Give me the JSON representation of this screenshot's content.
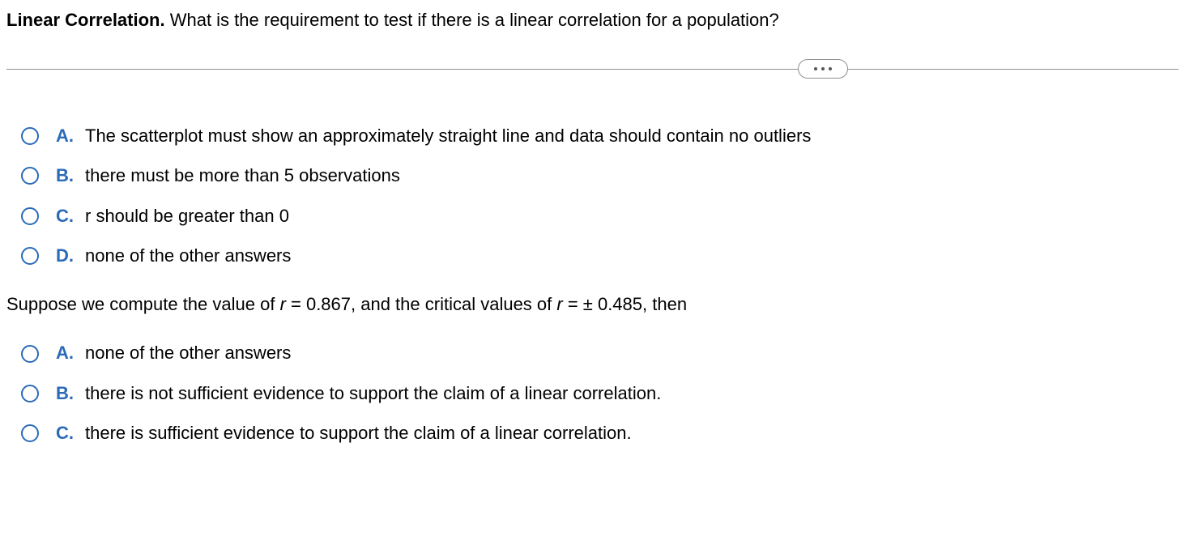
{
  "header": {
    "title_bold": "Linear Correlation.",
    "title_rest": " What is the requirement to test if there is a linear correlation for a population?"
  },
  "question1": {
    "options": [
      {
        "letter": "A.",
        "text": "The scatterplot must show an approximately straight line and data should contain no outliers"
      },
      {
        "letter": "B.",
        "text": "there must be more than 5 observations"
      },
      {
        "letter": "C.",
        "text": "r should be greater than 0"
      },
      {
        "letter": "D.",
        "text": "none of the other answers"
      }
    ]
  },
  "subquestion": {
    "prefix": "Suppose we compute the value of ",
    "r": "r",
    "eq1": " = 0.867, and the critical values of ",
    "r2": "r",
    "eq2": " =  ± 0.485, then"
  },
  "question2": {
    "options": [
      {
        "letter": "A.",
        "text": "none of the other answers"
      },
      {
        "letter": "B.",
        "text": "there is not sufficient evidence to support the claim of a linear correlation."
      },
      {
        "letter": "C.",
        "text": "there is sufficient evidence to support the claim of a linear correlation."
      }
    ]
  }
}
